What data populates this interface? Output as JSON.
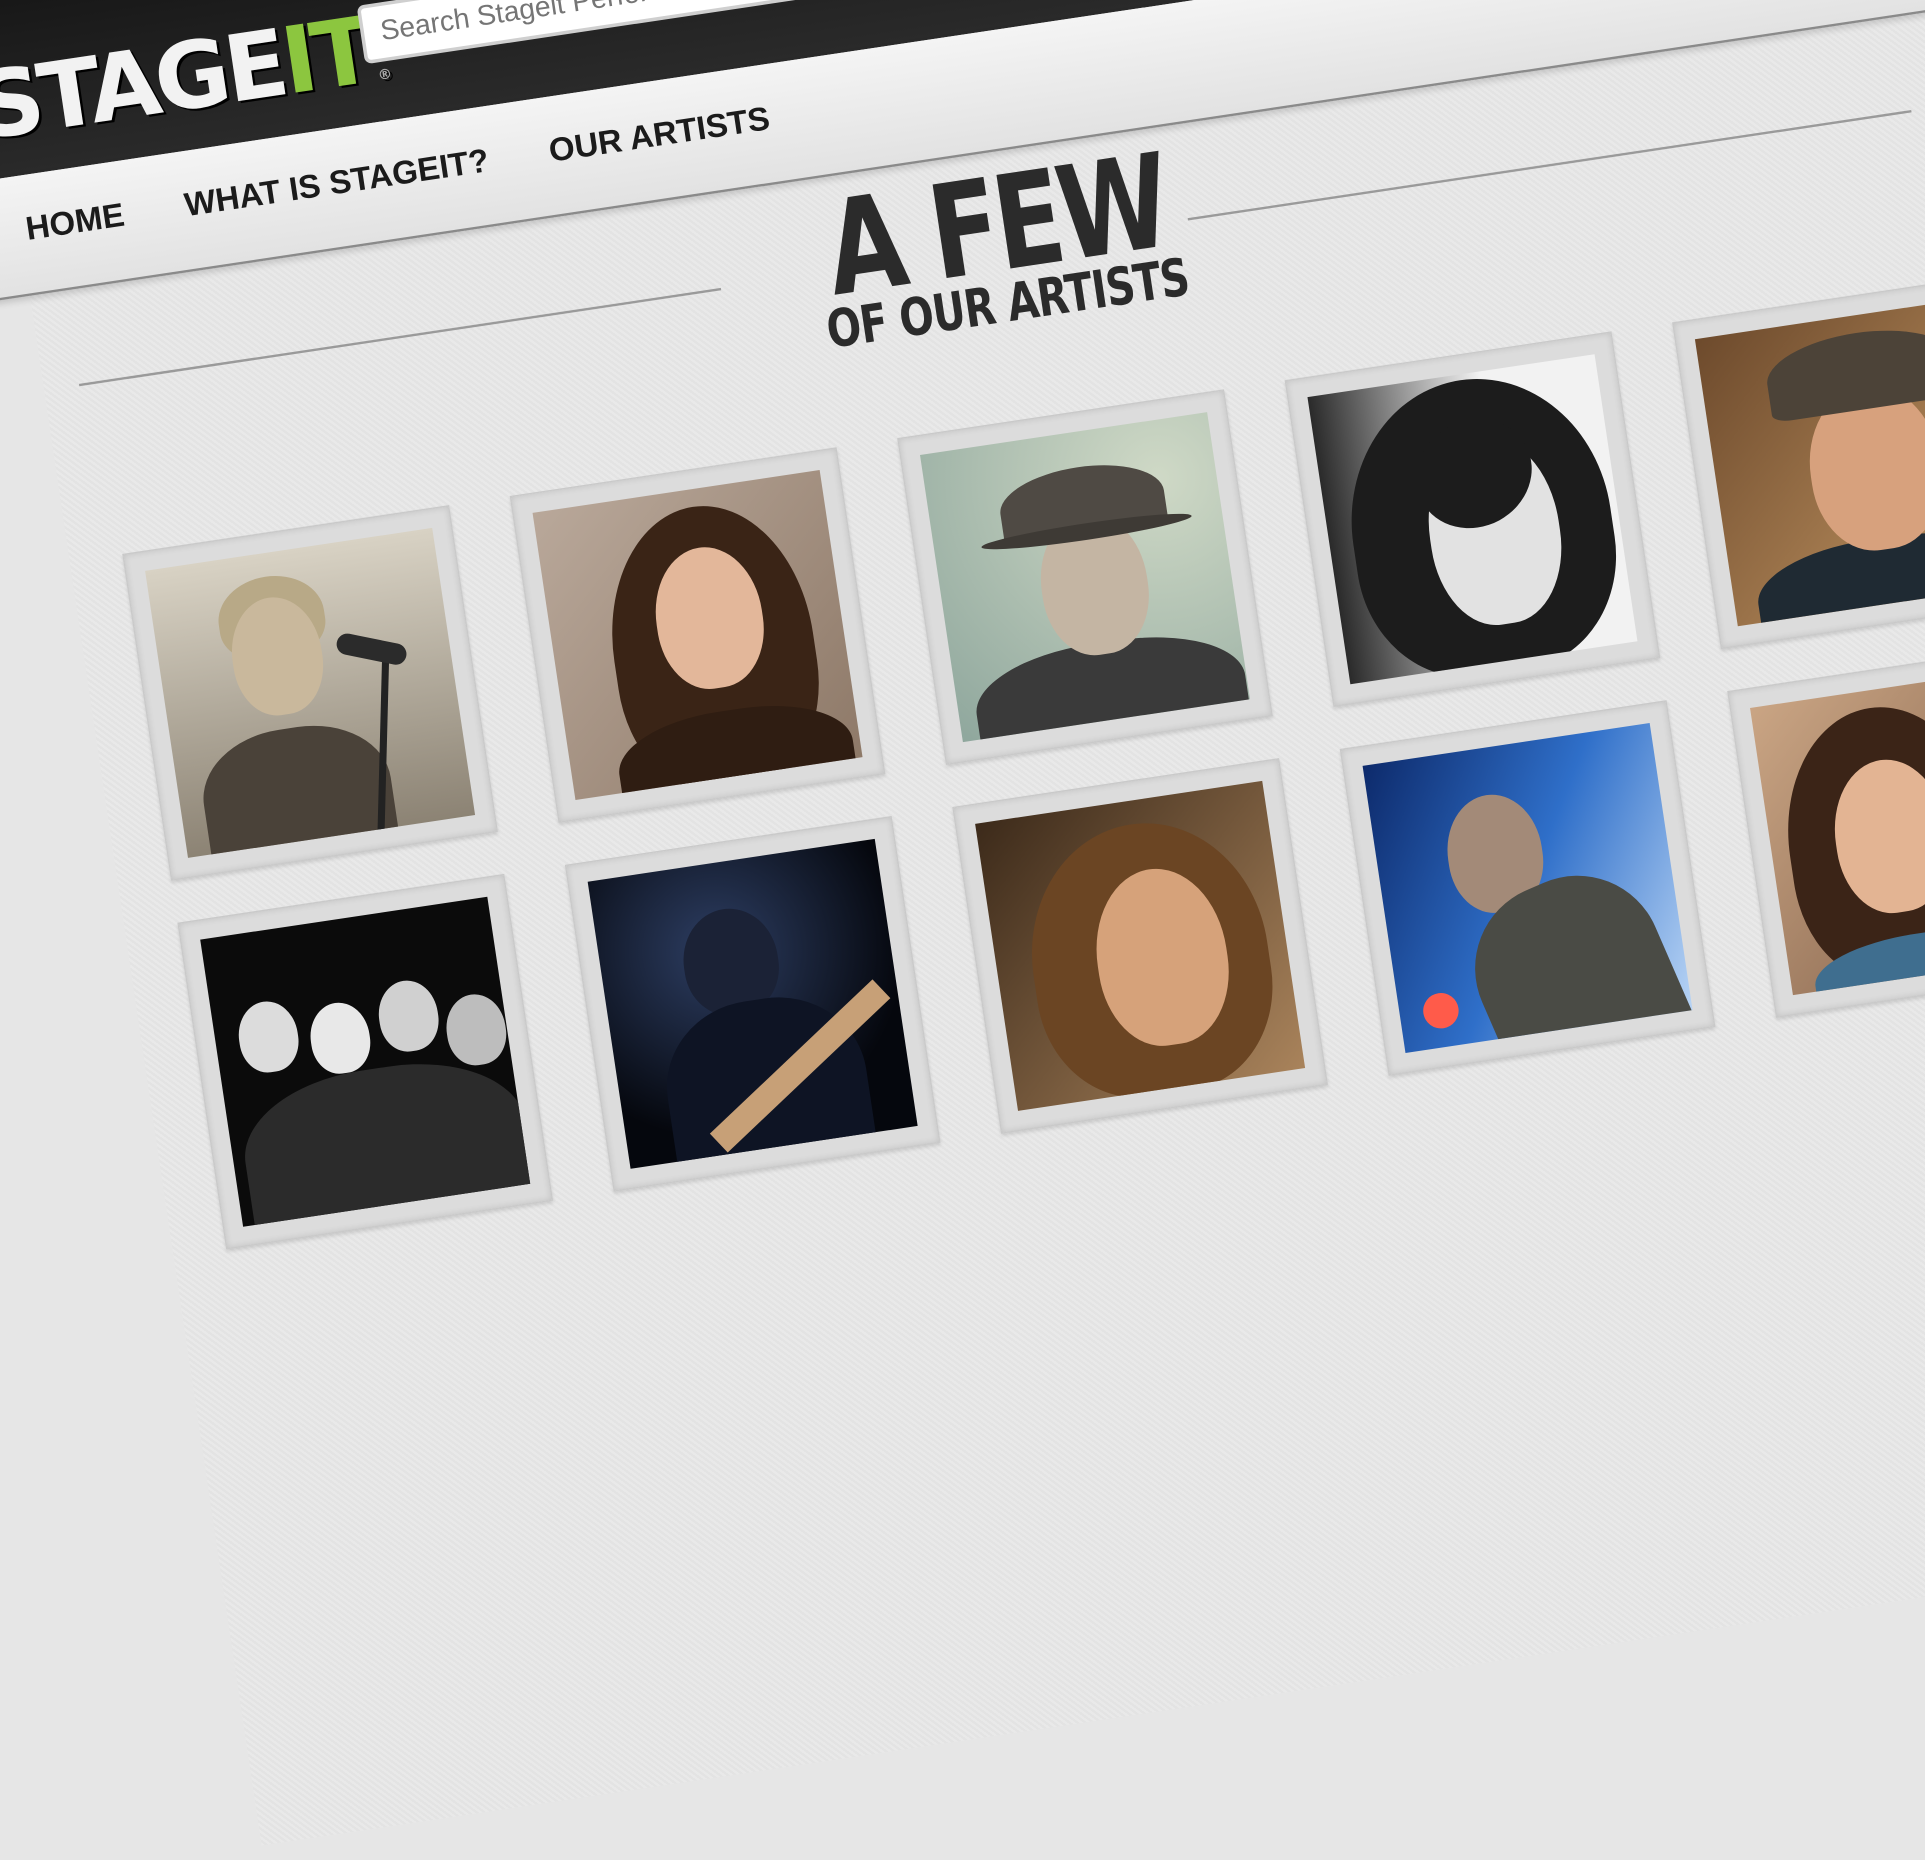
{
  "header": {
    "logo": {
      "main": "STAGE",
      "accent": "IT",
      "mark": "®",
      "accent_color": "#8cc63f"
    },
    "search": {
      "placeholder": "Search Stageit Performers, Shows"
    }
  },
  "nav": {
    "items": [
      {
        "label": "HOME"
      },
      {
        "label": "WHAT IS STAGEIT?"
      },
      {
        "label": "OUR ARTISTS"
      }
    ]
  },
  "section": {
    "title_big": "A FEW",
    "title_small": "OF OUR ARTISTS"
  },
  "artists": [
    {
      "tone": "sepia"
    },
    {
      "tone": "warm"
    },
    {
      "tone": "teal"
    },
    {
      "tone": "bw"
    },
    {
      "tone": "brown"
    },
    {
      "tone": "dark-group"
    },
    {
      "tone": "dark-guitar"
    },
    {
      "tone": "golden"
    },
    {
      "tone": "blue-stage"
    },
    {
      "tone": "warm-2"
    }
  ]
}
